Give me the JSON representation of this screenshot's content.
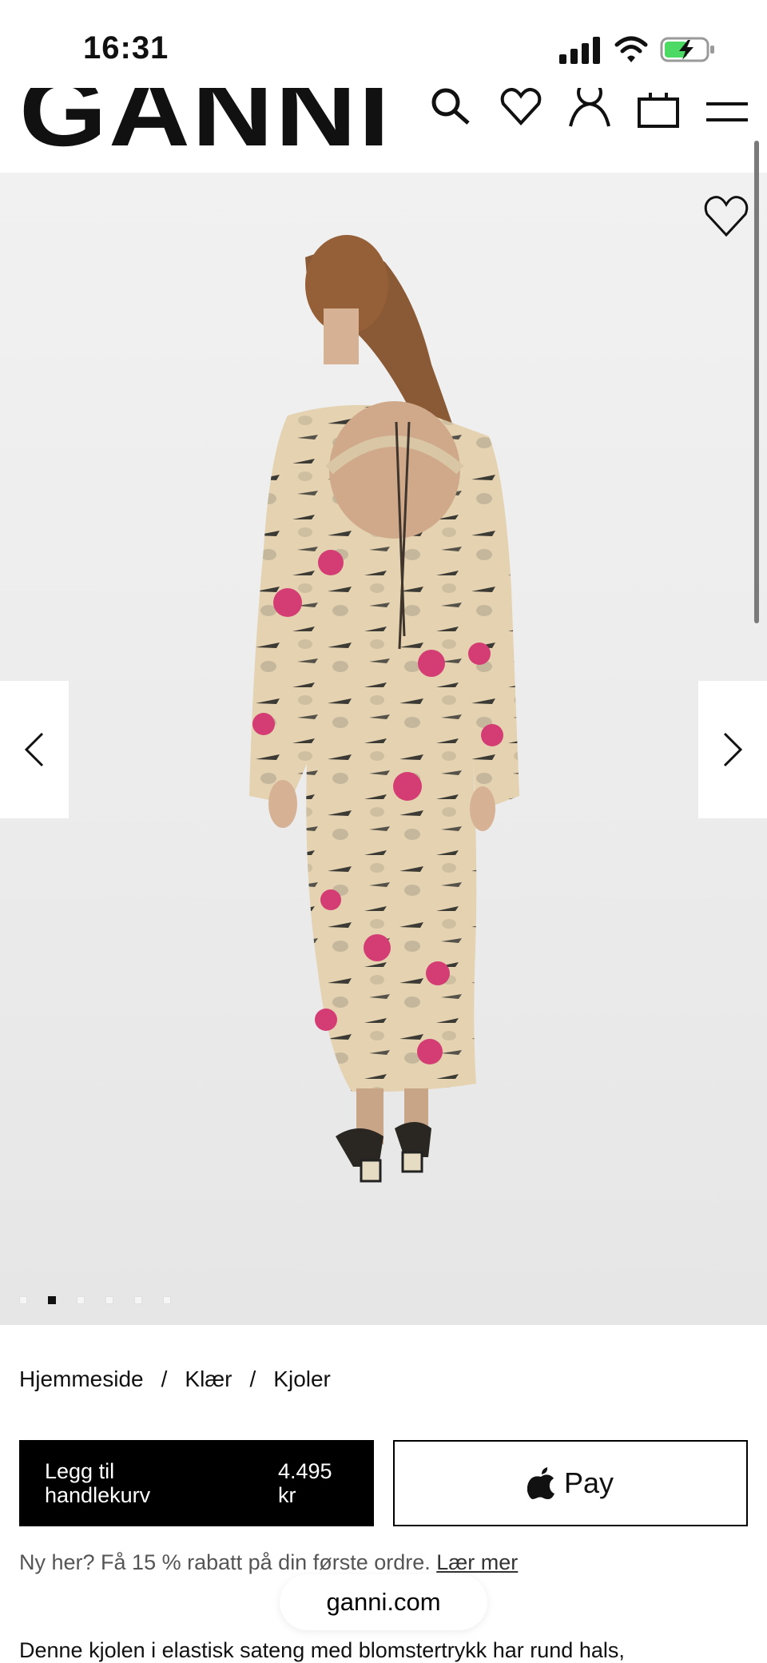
{
  "status_bar": {
    "time": "16:31"
  },
  "header": {
    "logo": "GANNI",
    "icons": [
      "search-icon",
      "wishlist-icon",
      "account-icon",
      "bag-icon",
      "menu-icon"
    ]
  },
  "gallery": {
    "slide_count": 6,
    "active_slide": 2
  },
  "breadcrumb": {
    "items": [
      "Hjemmeside",
      "Klær",
      "Kjoler"
    ],
    "separator": "/"
  },
  "purchase": {
    "add_to_cart_label": "Legg til\nhandlekurv",
    "price": "4.495\nkr",
    "apple_pay_label": "Pay"
  },
  "promo": {
    "text": "Ny her? Få 15 % rabatt på din første ordre.",
    "link": "Lær mer"
  },
  "browser": {
    "url": "ganni.com"
  },
  "description": {
    "text": "Denne kjolen i elastisk sateng med blomstertrykk har rund hals,"
  },
  "colors": {
    "accent": "#000000",
    "print_pink": "#d8407a",
    "print_base": "#e6d4b4"
  }
}
